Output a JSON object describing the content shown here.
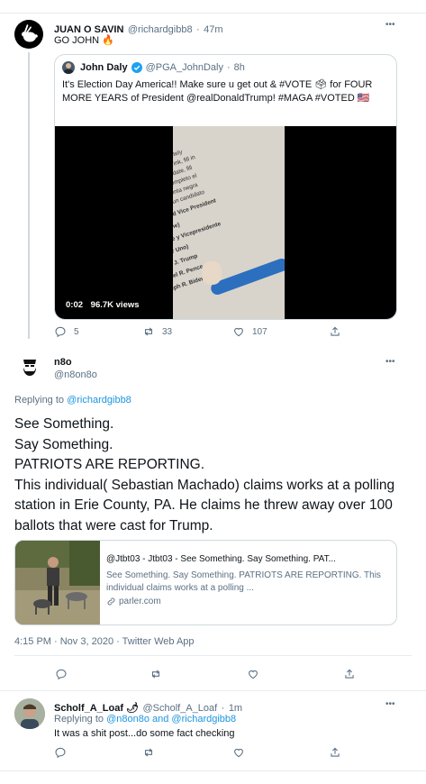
{
  "tweet1": {
    "name": "JUAN O SAVIN",
    "handle": "@richardgibb8",
    "time": "47m",
    "text": "GO JOHN 🔥",
    "quoted": {
      "name": "John Daly",
      "handle": "@PGA_JohnDaly",
      "time": "8h",
      "text": "It's Election Day America!! Make sure u get out & #VOTE 🗳 for FOUR MORE YEARS of President @realDonaldTrump! #MAGA #VOTED 🇺🇸",
      "video_time": "0:02",
      "video_views": "96.7K views"
    },
    "replies": "5",
    "retweets": "33",
    "likes": "107"
  },
  "tweet2": {
    "name": "n8o",
    "handle": "@n8on8o",
    "replying_prefix": "Replying to ",
    "replying_to": "@richardgibb8",
    "lines": [
      "See Something.",
      "Say Something.",
      "PATRIOTS ARE REPORTING.",
      "This individual( Sebastian Machado) claims works at a polling station in Erie County, PA. He claims he threw away over 100 ballots that were cast for Trump."
    ],
    "card": {
      "title": "@Jtbt03 - Jtbt03 - See Something. Say Something. PAT...",
      "desc": "See Something. Say Something. PATRIOTS ARE REPORTING. This individual claims works at a polling ...",
      "domain": "parler.com"
    },
    "meta": "4:15 PM · Nov 3, 2020 · Twitter Web App"
  },
  "tweet3": {
    "name": "Scholf_A_Loaf 🌶",
    "handle": "@Scholf_A_Loaf",
    "time": "1m",
    "replying_prefix": "Replying to ",
    "replying_to": "@n8on8o and @richardgibb8",
    "text": "It was a shit post...do some fact checking"
  },
  "ballot": {
    "lines": [
      "fill in the oval completely",
      "print pen with black ink, fill in",
      "for a write-in candidate, fill",
      "votar, llene por completo el",
      "un boligrafo de tinta negra",
      "Para votar por un candidato",
      "President and Vice President",
      "(Vote for One)",
      "Presidente y Vicepresidente",
      "(Vote por Uno)",
      "Donald J. Trump",
      "Michael R. Pence",
      "Joseph R. Biden"
    ]
  },
  "icons": {
    "more": "more-icon",
    "reply": "reply-icon",
    "retweet": "retweet-icon",
    "like": "like-icon",
    "share": "share-icon",
    "verified": "verified-badge-icon",
    "link": "link-icon"
  },
  "colors": {
    "link": "#1b95e0",
    "secondary": "#5b7083",
    "verified": "#1da1f2"
  }
}
